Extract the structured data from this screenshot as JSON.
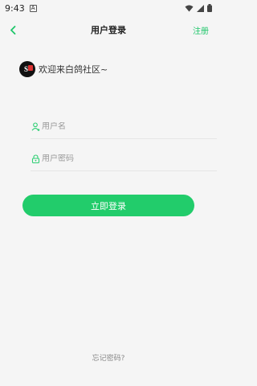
{
  "status": {
    "time": "9:43",
    "notif_glyph": "A"
  },
  "header": {
    "title": "用户登录",
    "register_label": "注册",
    "back_icon": "chevron-left-icon"
  },
  "welcome": {
    "text": "欢迎来白鸽社区~"
  },
  "form": {
    "username_placeholder": "用户名",
    "password_placeholder": "用户密码",
    "username_value": "",
    "password_value": ""
  },
  "actions": {
    "login_label": "立即登录",
    "forgot_label": "忘记密码?"
  },
  "colors": {
    "accent": "#22cc6b",
    "background": "#f5f5f5",
    "text": "#222222"
  }
}
